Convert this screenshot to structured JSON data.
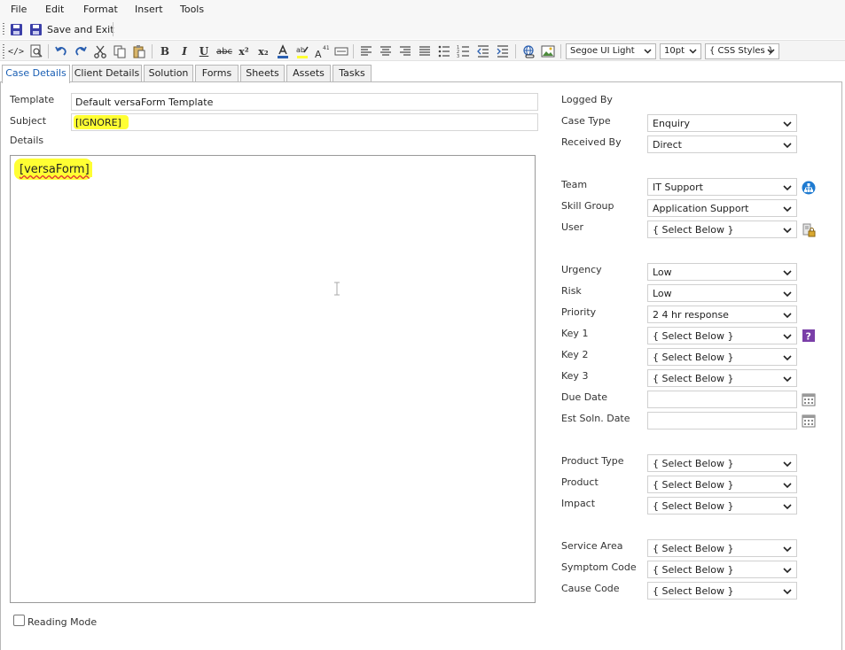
{
  "menu": [
    "File",
    "Edit",
    "Format",
    "Insert",
    "Tools"
  ],
  "quickbar": {
    "save_and_exit": "Save and Exit"
  },
  "toolbar": {
    "font": "Segoe UI Light",
    "size": "10pt",
    "styles": "{ CSS Styles }",
    "bold": "B",
    "italic": "I",
    "underline": "U",
    "strike": "abc",
    "superscript": "x²",
    "subscript": "x₂",
    "icons": [
      "source-code-icon",
      "preview-icon",
      "undo-icon",
      "redo-icon",
      "cut-icon",
      "copy-icon",
      "paste-icon",
      "bold-icon",
      "italic-icon",
      "underline-icon",
      "strikethrough-icon",
      "superscript-icon",
      "subscript-icon",
      "font-color-icon",
      "highlight-icon",
      "font-size-icon",
      "horizontal-rule-icon",
      "align-left-icon",
      "align-center-icon",
      "align-right-icon",
      "justify-icon",
      "bullet-list-icon",
      "numbered-list-icon",
      "outdent-icon",
      "indent-icon",
      "link-icon",
      "image-icon"
    ]
  },
  "tabs": [
    "Case Details",
    "Client Details",
    "Solution",
    "Forms",
    "Sheets",
    "Assets",
    "Tasks"
  ],
  "form": {
    "template_label": "Template",
    "template_value": "Default versaForm Template",
    "subject_label": "Subject",
    "subject_value": "[IGNORE]",
    "details_label": "Details",
    "details_text": "[versaForm]",
    "reading_mode": "Reading Mode"
  },
  "right": {
    "logged_by": "Logged By",
    "case_type": {
      "label": "Case Type",
      "value": "Enquiry"
    },
    "received_by": {
      "label": "Received By",
      "value": "Direct"
    },
    "team": {
      "label": "Team",
      "value": "IT Support"
    },
    "skill_group": {
      "label": "Skill Group",
      "value": "Application Support"
    },
    "user": {
      "label": "User",
      "value": "{ Select Below }"
    },
    "urgency": {
      "label": "Urgency",
      "value": "Low"
    },
    "risk": {
      "label": "Risk",
      "value": "Low"
    },
    "priority": {
      "label": "Priority",
      "value": "2 4 hr response"
    },
    "key1": {
      "label": "Key 1",
      "value": "{ Select Below }"
    },
    "key2": {
      "label": "Key 2",
      "value": "{ Select Below }"
    },
    "key3": {
      "label": "Key 3",
      "value": "{ Select Below }"
    },
    "due_date": {
      "label": "Due Date",
      "value": ""
    },
    "est_soln_date": {
      "label": "Est Soln. Date",
      "value": ""
    },
    "product_type": {
      "label": "Product Type",
      "value": "{ Select Below }"
    },
    "product": {
      "label": "Product",
      "value": "{ Select Below }"
    },
    "impact": {
      "label": "Impact",
      "value": "{ Select Below }"
    },
    "service_area": {
      "label": "Service Area",
      "value": "{ Select Below }"
    },
    "symptom_code": {
      "label": "Symptom Code",
      "value": "{ Select Below }"
    },
    "cause_code": {
      "label": "Cause Code",
      "value": "{ Select Below }"
    }
  },
  "colors": {
    "accent": "#1a5fb4",
    "save_icon": "#3b3fa8",
    "highlight": "#ffff33",
    "help_icon": "#7a3fa8"
  }
}
